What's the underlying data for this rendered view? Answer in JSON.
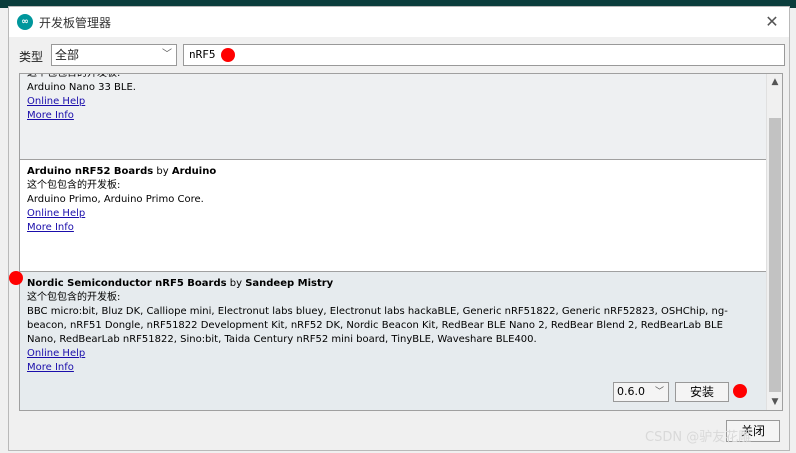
{
  "window": {
    "title": "开发板管理器",
    "close_icon": "close-icon"
  },
  "filter": {
    "type_label": "类型",
    "type_value": "全部",
    "search_value": "nRF5"
  },
  "boards": [
    {
      "partial_heading": "这个包包含的开发板:",
      "boards_text": "Arduino Nano 33 BLE.",
      "online_help": "Online Help",
      "more_info": "More Info"
    },
    {
      "name": "Arduino nRF52 Boards",
      "by": "by",
      "author": "Arduino",
      "contains_label": "这个包包含的开发板:",
      "boards_text": "Arduino Primo, Arduino Primo Core.",
      "online_help": "Online Help",
      "more_info": "More Info"
    },
    {
      "name": "Nordic Semiconductor nRF5 Boards",
      "by": "by",
      "author": "Sandeep Mistry",
      "contains_label": "这个包包含的开发板:",
      "boards_text": "BBC micro:bit, Bluz DK, Calliope mini, Electronut labs bluey, Electronut labs hackaBLE, Generic nRF51822, Generic nRF52823, OSHChip, ng-beacon, nRF51 Dongle, nRF51822 Development Kit, nRF52 DK, Nordic Beacon Kit, RedBear BLE Nano 2, RedBear Blend 2, RedBearLab BLE Nano, RedBearLab nRF51822, Sino:bit, Taida Century nRF52 mini board, TinyBLE, Waveshare BLE400.",
      "online_help": "Online Help",
      "more_info": "More Info",
      "version": "0.6.0",
      "install_label": "安装"
    }
  ],
  "footer": {
    "close_label": "关闭",
    "watermark": "CSDN @驴友花雕"
  },
  "colors": {
    "accent": "#00979c",
    "marker": "#ff0000",
    "link": "#1a0dab"
  }
}
